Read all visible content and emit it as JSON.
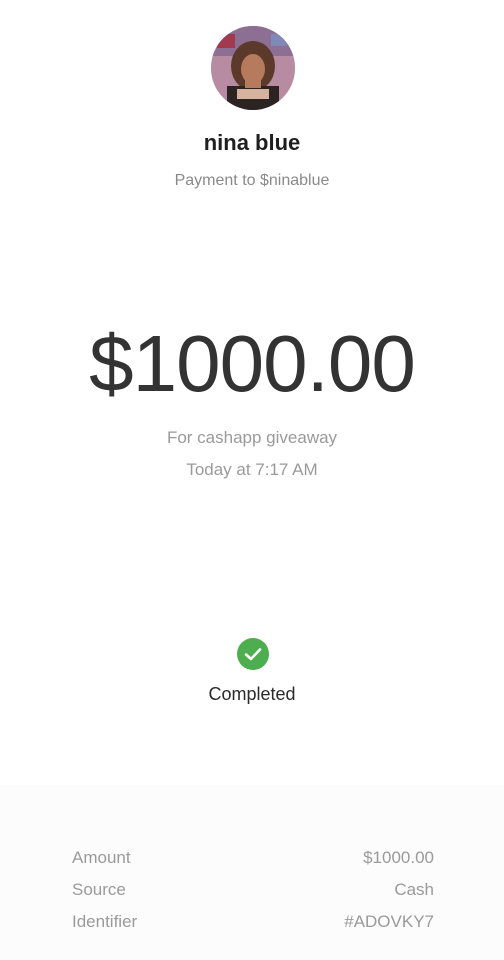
{
  "recipient": {
    "name": "nina blue",
    "payment_to": "Payment to $ninablue"
  },
  "payment": {
    "amount": "$1000.00",
    "note": "For cashapp giveaway",
    "time": "Today at 7:17 AM",
    "status": "Completed"
  },
  "details": [
    {
      "label": "Amount",
      "value": "$1000.00"
    },
    {
      "label": "Source",
      "value": "Cash"
    },
    {
      "label": "Identifier",
      "value": "#ADOVKY7"
    }
  ],
  "icons": {
    "status": "check-circle-icon",
    "avatar": "profile-photo"
  },
  "colors": {
    "success": "#4cae4f",
    "amount_text": "#333333",
    "muted_text": "#9a9a9a"
  }
}
